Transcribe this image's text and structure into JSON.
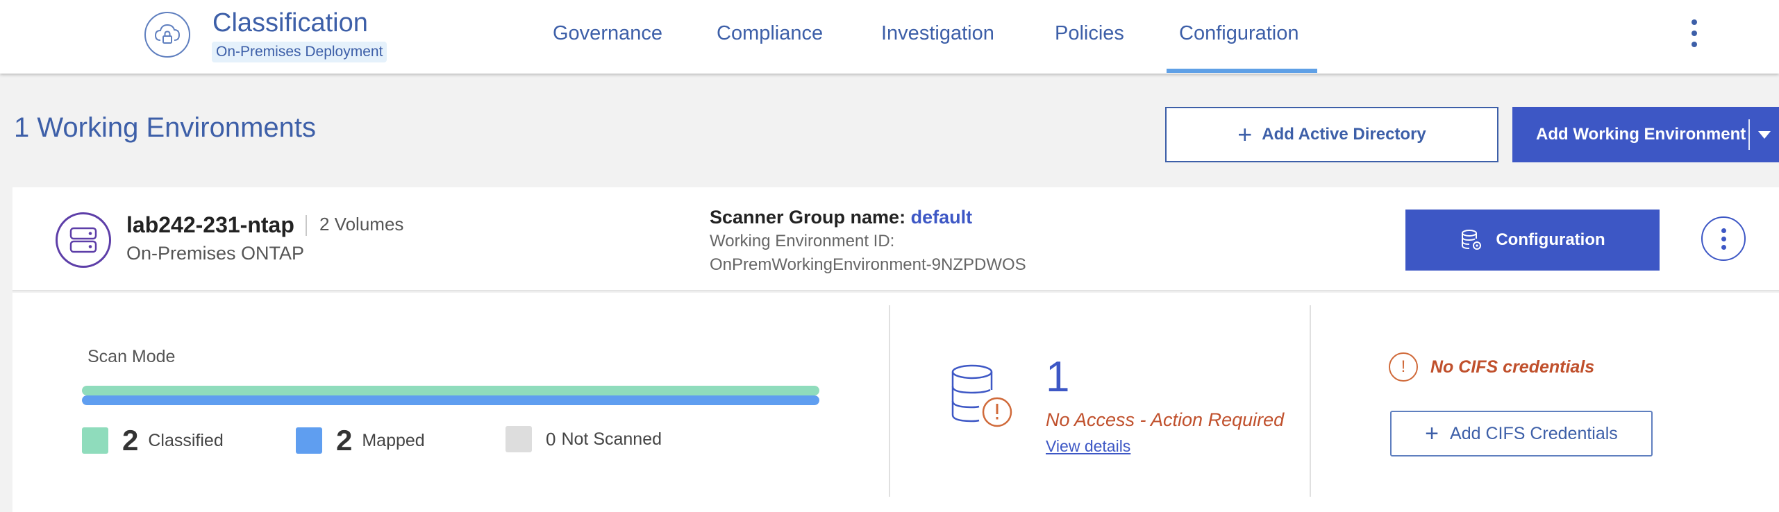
{
  "header": {
    "title": "Classification",
    "badge": "On-Premises Deployment",
    "logo_icon": "cloud-lock-icon",
    "nav": [
      {
        "label": "Governance"
      },
      {
        "label": "Compliance"
      },
      {
        "label": "Investigation"
      },
      {
        "label": "Policies"
      },
      {
        "label": "Configuration",
        "active": true
      }
    ],
    "menu_icon": "kebab-menu-icon"
  },
  "page": {
    "title": "1 Working Environments",
    "add_ad_label": "Add Active Directory",
    "add_we_label": "Add Working Environment"
  },
  "environment": {
    "name": "lab242-231-ntap",
    "volumes": "2 Volumes",
    "type": "On-Premises ONTAP",
    "scanner_group_label": "Scanner Group name:",
    "scanner_group_value": "default",
    "id_label": "Working Environment ID:",
    "id_value": "OnPremWorkingEnvironment-9NZPDWOS",
    "config_button": "Configuration",
    "scan": {
      "label": "Scan Mode",
      "classified_fraction": 1.0,
      "mapped_fraction": 1.0,
      "legend": [
        {
          "count": "2",
          "label": "Classified",
          "color": "#8fdcbc"
        },
        {
          "count": "2",
          "label": "Mapped",
          "color": "#5f9ef0"
        },
        {
          "count": "0",
          "label": "Not Scanned",
          "color": "#dddddd"
        }
      ]
    },
    "no_access": {
      "count": "1",
      "label": "No Access - Action Required",
      "link": "View details"
    },
    "cifs": {
      "warning": "No CIFS credentials",
      "button": "Add CIFS Credentials"
    }
  },
  "colors": {
    "brand": "#3d57c5",
    "accent_underline": "#5fa0e6",
    "warning": "#c0502c"
  }
}
